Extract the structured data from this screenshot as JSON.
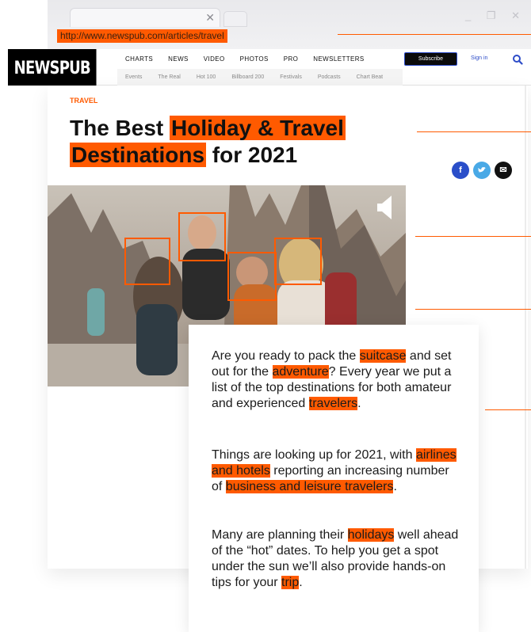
{
  "browser": {
    "url": "http://www.newspub.com/articles/travel",
    "tab_close": "✕",
    "window_controls": "_ ❐ ✕"
  },
  "site": {
    "logo": "NEWSPUB",
    "nav_main": [
      "CHARTS",
      "NEWS",
      "VIDEO",
      "PHOTOS",
      "PRO",
      "NEWSLETTERS"
    ],
    "nav_sub": [
      "Events",
      "The Real",
      "Hot 100",
      "Billboard 200",
      "Festivals",
      "Podcasts",
      "Chart Beat"
    ],
    "subscribe_label": "Subscribe",
    "signin_label": "Sign in"
  },
  "article": {
    "section": "TRAVEL",
    "title": {
      "part1": "The Best ",
      "highlight1": "Holiday & Travel",
      "highlight2": "Destinations",
      "part2": " for 2021"
    },
    "share": {
      "facebook": "f",
      "twitter": "t",
      "email": "✉"
    },
    "paragraphs": [
      {
        "t1": "Are you ready to pack the ",
        "m1": "suitcase",
        "t2": " and set out for the ",
        "m2": "adventure",
        "t3": "? Every year we put a list of the top destinations for both amateur and experienced ",
        "m3": "travelers",
        "t4": "."
      },
      {
        "t1": "Things are looking up for 2021, with ",
        "m1": "airlines and hotels",
        "t2": " reporting an increasing number of ",
        "m2": "business and leisure travelers",
        "t3": "."
      },
      {
        "t1": "Many are planning their ",
        "m1": "holidays",
        "t2": " well ahead of the “hot” dates. To help you get a spot under the sun we’ll also provide hands-on tips for your ",
        "m2": "trip",
        "t3": "."
      }
    ]
  },
  "colors": {
    "accent": "#ff5a00",
    "brand_black": "#000000",
    "link_blue": "#2d4cc8"
  }
}
